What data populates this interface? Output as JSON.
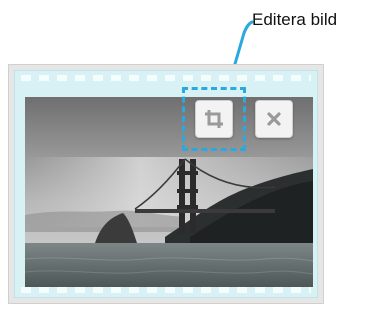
{
  "callout": {
    "label": "Editera bild",
    "color": "#2aa9e0"
  },
  "photo_card": {
    "buttons": [
      {
        "name": "crop",
        "icon": "crop-icon"
      },
      {
        "name": "close",
        "icon": "close-icon"
      }
    ]
  },
  "colors": {
    "frame": "#d8f1f4",
    "highlight": "#2aa9e0",
    "button_bg": "#f3f3f3",
    "icon": "#9a9a9a"
  }
}
